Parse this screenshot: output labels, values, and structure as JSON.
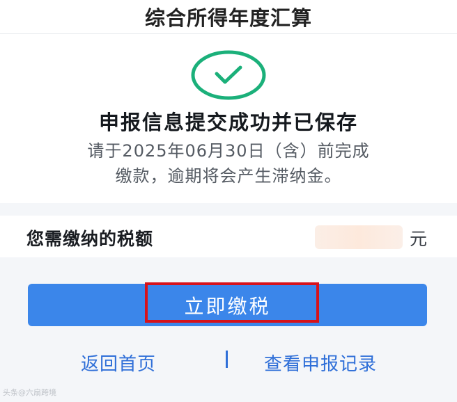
{
  "header": {
    "title": "综合所得年度汇算"
  },
  "result": {
    "icon": "check-circle-icon",
    "icon_color": "#1bb07a",
    "title": "申报信息提交成功并已保存",
    "description": "请于2025年06月30日（含）前完成缴款，逾期将会产生滞纳金。"
  },
  "tax": {
    "label": "您需缴纳的税额",
    "unit": "元"
  },
  "actions": {
    "pay_label": "立即缴税",
    "pay_color": "#3b86ea",
    "highlight_color": "#d7121a",
    "home_label": "返回首页",
    "divider": "|",
    "records_label": "查看申报记录",
    "link_color": "#2f6fd8"
  },
  "watermark": "头条@六扇跨境"
}
